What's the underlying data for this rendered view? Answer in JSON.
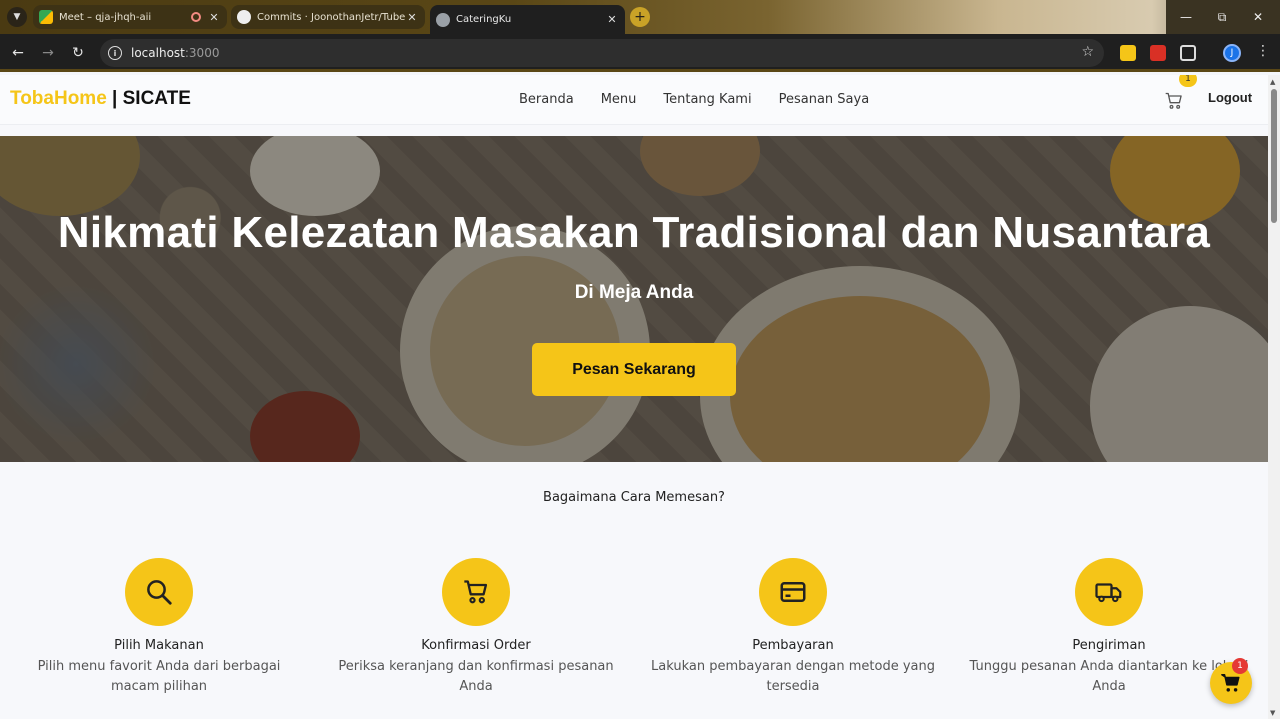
{
  "browser": {
    "tabs": [
      {
        "title": "Meet – qja-jhqh-aii",
        "recording": true
      },
      {
        "title": "Commits · JoonothanJetr/Tuber"
      },
      {
        "title": "CateringKu",
        "active": true
      }
    ],
    "url": {
      "host": "localhost",
      "port": ":3000"
    },
    "profile_initial": "J"
  },
  "header": {
    "brand_primary": "TobaHome",
    "brand_secondary": " | SICATE",
    "nav": [
      "Beranda",
      "Menu",
      "Tentang Kami",
      "Pesanan Saya"
    ],
    "cart_count": "1",
    "logout_label": "Logout"
  },
  "hero": {
    "title": "Nikmati Kelezatan Masakan Tradisional dan Nusantara",
    "subtitle": "Di Meja Anda",
    "cta_label": "Pesan Sekarang"
  },
  "how": {
    "title": "Bagaimana Cara Memesan?",
    "steps": [
      {
        "icon": "search-icon",
        "title": "Pilih Makanan",
        "desc": "Pilih menu favorit Anda dari berbagai macam pilihan"
      },
      {
        "icon": "cart-icon",
        "title": "Konfirmasi Order",
        "desc": "Periksa keranjang dan konfirmasi pesanan Anda"
      },
      {
        "icon": "credit-card-icon",
        "title": "Pembayaran",
        "desc": "Lakukan pembayaran dengan metode yang tersedia"
      },
      {
        "icon": "truck-icon",
        "title": "Pengiriman",
        "desc": "Tunggu pesanan Anda diantarkan ke lokasi Anda"
      }
    ]
  },
  "floating_cart": {
    "count": "1"
  },
  "colors": {
    "accent": "#f5c518",
    "text": "#222222"
  }
}
